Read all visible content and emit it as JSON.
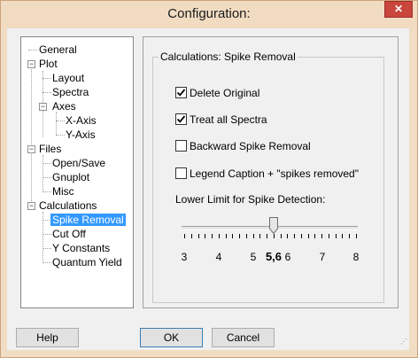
{
  "window": {
    "title": "Configuration:",
    "close_glyph": "✕"
  },
  "tree": {
    "items": [
      {
        "label": "General"
      },
      {
        "label": "Plot"
      },
      {
        "label": "Layout"
      },
      {
        "label": "Spectra"
      },
      {
        "label": "Axes"
      },
      {
        "label": "X-Axis"
      },
      {
        "label": "Y-Axis"
      },
      {
        "label": "Files"
      },
      {
        "label": "Open/Save"
      },
      {
        "label": "Gnuplot"
      },
      {
        "label": "Misc"
      },
      {
        "label": "Calculations"
      },
      {
        "label": "Spike Removal"
      },
      {
        "label": "Cut Off"
      },
      {
        "label": "Y Constants"
      },
      {
        "label": "Quantum Yield"
      }
    ],
    "expander_glyph": "−"
  },
  "group": {
    "title": "Calculations: Spike Removal"
  },
  "options": [
    {
      "label": "Delete Original",
      "checked": true
    },
    {
      "label": "Treat all Spectra",
      "checked": true
    },
    {
      "label": "Backward Spike Removal",
      "checked": false
    },
    {
      "label": "Legend Caption + \"spikes removed\"",
      "checked": false
    }
  ],
  "slider": {
    "label": "Lower Limit for Spike Detection:",
    "min": 3,
    "max": 8,
    "value": 5.6,
    "value_label": "5,6",
    "tick_labels": [
      "3",
      "4",
      "5",
      "6",
      "7",
      "8"
    ]
  },
  "buttons": {
    "help": "Help",
    "ok": "OK",
    "cancel": "Cancel"
  }
}
